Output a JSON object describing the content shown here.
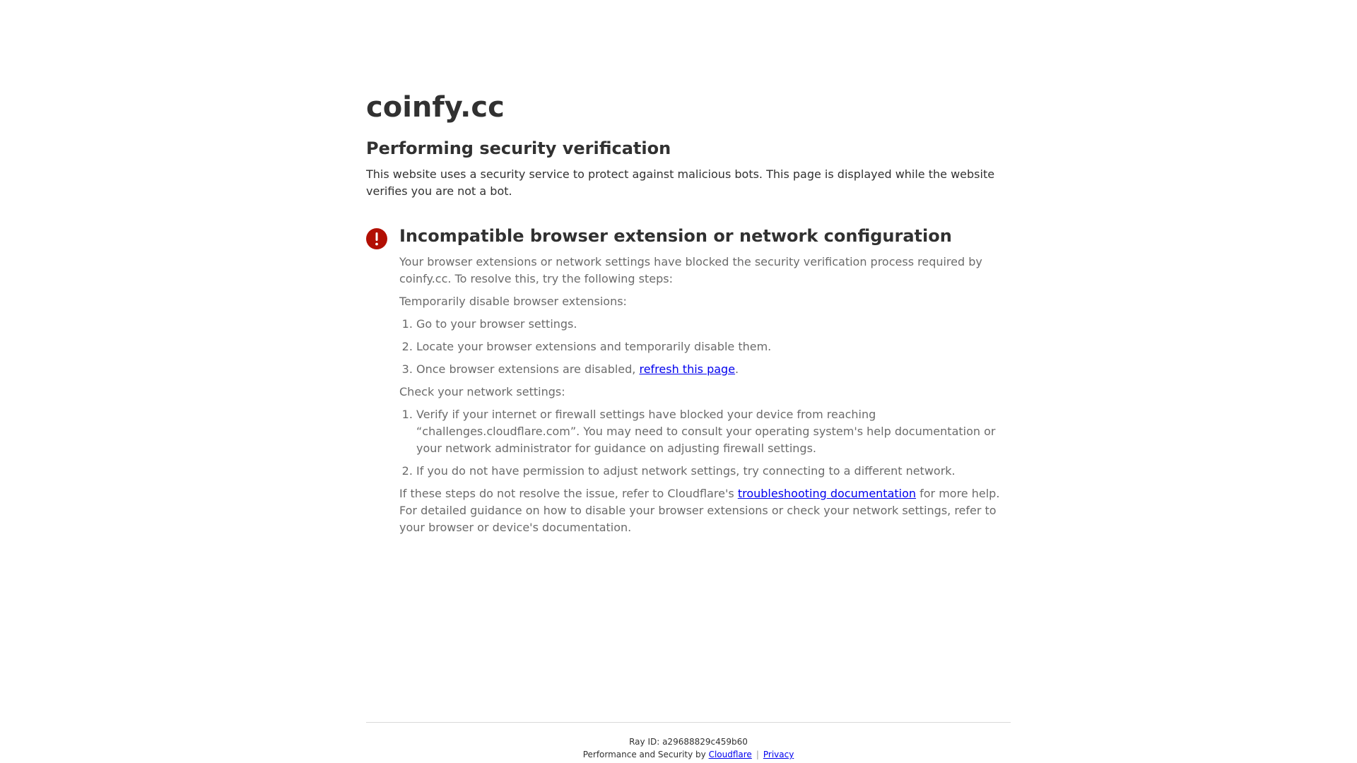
{
  "site": {
    "name": "coinfy.cc"
  },
  "heading": "Performing security verification",
  "intro": "This website uses a security service to protect against malicious bots. This page is displayed while the website verifies you are not a bot.",
  "error": {
    "icon": "exclamation-icon",
    "title": "Incompatible browser extension or network configuration",
    "description": "Your browser extensions or network settings have blocked the security verification process required by coinfy.cc. To resolve this, try the following steps:",
    "extensions_heading": "Temporarily disable browser extensions:",
    "extension_steps": {
      "step1": "Go to your browser settings.",
      "step2": "Locate your browser extensions and temporarily disable them.",
      "step3_prefix": "Once browser extensions are disabled, ",
      "step3_link": "refresh this page",
      "step3_suffix": "."
    },
    "network_heading": "Check your network settings:",
    "network_steps": {
      "step1": "Verify if your internet or firewall settings have blocked your device from reaching “challenges.cloudflare.com”. You may need to consult your operating system's help documentation or your network administrator for guidance on adjusting firewall settings.",
      "step2": "If you do not have permission to adjust network settings, try connecting to a different network."
    },
    "closing_prefix": "If these steps do not resolve the issue, refer to Cloudflare's ",
    "closing_link": "troubleshooting documentation",
    "closing_suffix": " for more help. For detailed guidance on how to disable your browser extensions or check your network settings, refer to your browser or device's documentation."
  },
  "footer": {
    "ray_label": "Ray ID: ",
    "ray_id": "a29688829c459b60",
    "perf_text": "Performance and Security by ",
    "cloudflare_link": "Cloudflare",
    "separator": "|",
    "privacy_link": "Privacy"
  },
  "colors": {
    "error_icon": "#b20f03",
    "link": "#0000ee",
    "text": "#313131",
    "muted_text": "#6b6b6b"
  }
}
